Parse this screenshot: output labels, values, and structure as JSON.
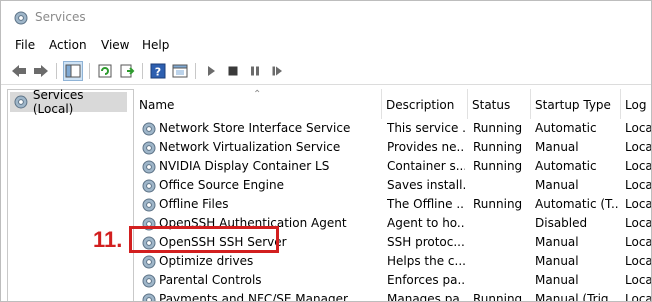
{
  "window": {
    "title": "Services"
  },
  "menu": [
    "File",
    "Action",
    "View",
    "Help"
  ],
  "tree": {
    "selected_label": "Services (Local)"
  },
  "table": {
    "columns": [
      "Name",
      "Description",
      "Status",
      "Startup Type",
      "Log"
    ],
    "rows": [
      {
        "name": "Network Store Interface Service",
        "description": "This service ...",
        "status": "Running",
        "startup": "Automatic",
        "log": "Loca"
      },
      {
        "name": "Network Virtualization Service",
        "description": "Provides ne...",
        "status": "Running",
        "startup": "Manual",
        "log": "Loca"
      },
      {
        "name": "NVIDIA Display Container LS",
        "description": "Container s...",
        "status": "Running",
        "startup": "Automatic",
        "log": "Loca"
      },
      {
        "name": "Office  Source Engine",
        "description": "Saves install...",
        "status": "",
        "startup": "Manual",
        "log": "Loca"
      },
      {
        "name": "Offline Files",
        "description": "The Offline ...",
        "status": "Running",
        "startup": "Automatic (T...",
        "log": "Loca"
      },
      {
        "name": "OpenSSH Authentication Agent",
        "description": "Agent to ho...",
        "status": "",
        "startup": "Disabled",
        "log": "Loca"
      },
      {
        "name": "OpenSSH SSH Server",
        "description": "SSH protoc...",
        "status": "",
        "startup": "Manual",
        "log": "Loca"
      },
      {
        "name": "Optimize drives",
        "description": "Helps the c...",
        "status": "",
        "startup": "Manual",
        "log": "Loca"
      },
      {
        "name": "Parental Controls",
        "description": "Enforces pa...",
        "status": "",
        "startup": "Manual",
        "log": "Loca"
      },
      {
        "name": "Payments and NFC/SE Manager",
        "description": "Manages pa...",
        "status": "Running",
        "startup": "Manual (Trig...",
        "log": "Loca"
      }
    ]
  },
  "annotation": {
    "step_label": "11.",
    "color": "#d21f1f"
  },
  "colors": {
    "tree_selected": "#d9d9d9",
    "title_gray": "#8a8a8a"
  },
  "icons": [
    "gear-icon",
    "back-icon",
    "forward-icon",
    "console-tree-icon",
    "refresh-icon",
    "export-icon",
    "help-icon",
    "properties-icon",
    "play-icon",
    "stop-icon",
    "pause-icon",
    "restart-icon"
  ]
}
